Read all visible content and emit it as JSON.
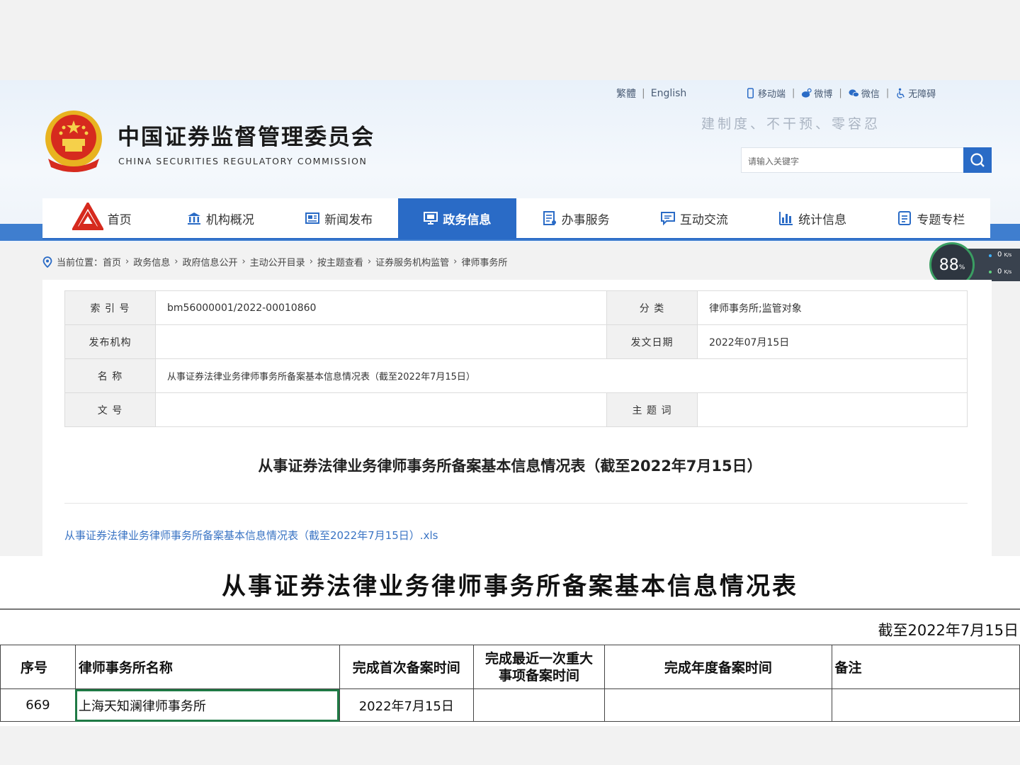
{
  "header": {
    "title": "中国证券监督管理委员会",
    "subtitle": "CHINA SECURITIES REGULATORY COMMISSION",
    "toplinks": [
      "繁體",
      "English"
    ],
    "toplinks2": [
      "移动端",
      "微博",
      "微信",
      "无障碍"
    ],
    "slogan": "建制度、不干预、零容忍",
    "search_placeholder": "请输入关键字"
  },
  "nav": {
    "items": [
      {
        "label": "首页",
        "icon": "csrc-logo-icon"
      },
      {
        "label": "机构概况",
        "icon": "bank-icon"
      },
      {
        "label": "新闻发布",
        "icon": "newspaper-icon"
      },
      {
        "label": "政务信息",
        "icon": "monitor-icon"
      },
      {
        "label": "办事服务",
        "icon": "document-icon"
      },
      {
        "label": "互动交流",
        "icon": "chat-icon"
      },
      {
        "label": "统计信息",
        "icon": "bar-chart-icon"
      },
      {
        "label": "专题专栏",
        "icon": "list-icon"
      }
    ],
    "active": "政务信息"
  },
  "breadcrumb": {
    "prefix": "当前位置：",
    "items": [
      "首页",
      "政务信息",
      "政府信息公开",
      "主动公开目录",
      "按主题查看",
      "证券服务机构监管",
      "律师事务所"
    ]
  },
  "speed_widget": {
    "percent": "88",
    "unit": "%",
    "up": "0",
    "down": "0",
    "rate_unit": "K/s"
  },
  "meta": {
    "index_label": "索 引 号",
    "index_value": "bm56000001/2022-00010860",
    "category_label": "分 类",
    "category_value": "律师事务所;监管对象",
    "publisher_label": "发布机构",
    "publisher_value": "",
    "date_label": "发文日期",
    "date_value": "2022年07月15日",
    "name_label": "名 称",
    "name_value": "从事证券法律业务律师事务所备案基本信息情况表（截至2022年7月15日）",
    "docno_label": "文 号",
    "docno_value": "",
    "keyword_label": "主 题 词",
    "keyword_value": ""
  },
  "doc_title": "从事证券法律业务律师事务所备案基本信息情况表（截至2022年7月15日）",
  "attachment": "从事证券法律业务律师事务所备案基本信息情况表（截至2022年7月15日）.xls",
  "sheet": {
    "title": "从事证券法律业务律师事务所备案基本信息情况表",
    "as_of": "截至2022年7月15日",
    "headers": [
      "序号",
      "律师事务所名称",
      "完成首次备案时间",
      "完成最近一次重大事项备案时间",
      "完成年度备案时间",
      "备注"
    ],
    "rows": [
      [
        "669",
        "上海天知澜律师事务所",
        "2022年7月15日",
        "",
        "",
        ""
      ]
    ]
  },
  "colors": {
    "brand_blue": "#2a6bc6",
    "link_blue": "#3a74c4",
    "selection_green": "#1f7a45"
  }
}
